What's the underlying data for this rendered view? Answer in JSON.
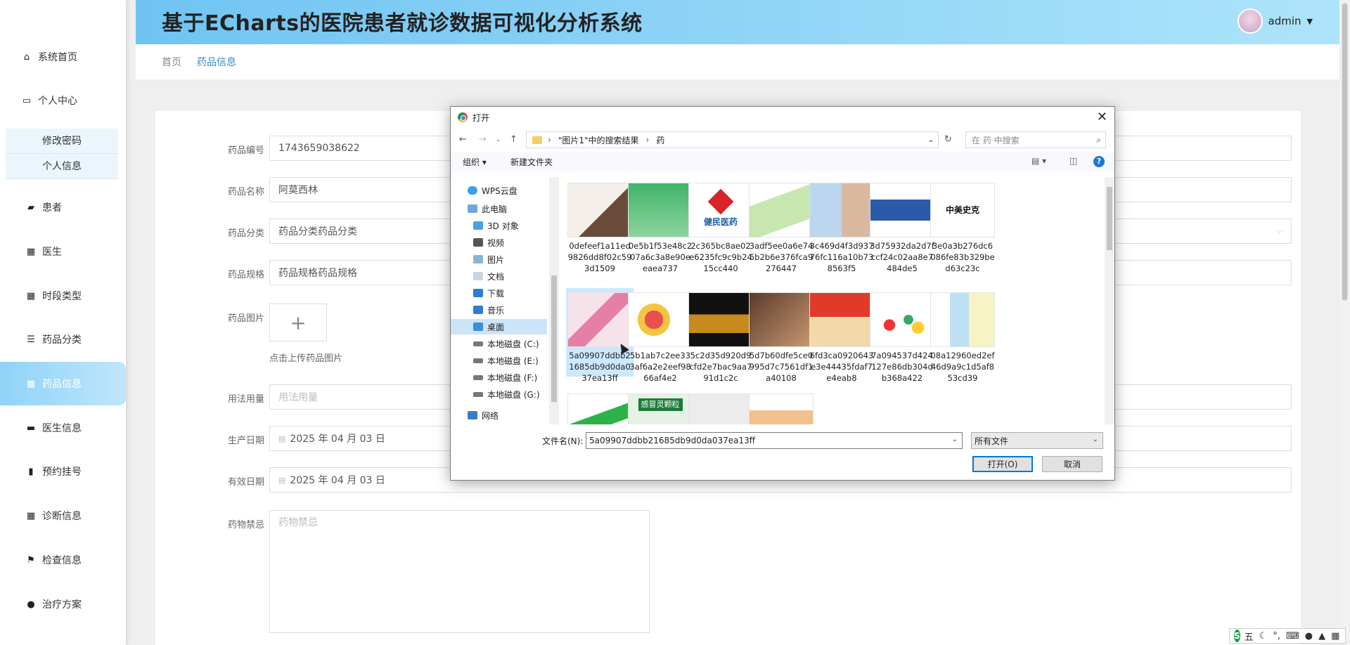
{
  "app": {
    "title": "基于ECharts的医院患者就诊数据可视化分析系统",
    "user": "admin"
  },
  "breadcrumb": {
    "home": "首页",
    "current": "药品信息"
  },
  "sidebar": {
    "items": [
      {
        "label": "系统首页",
        "icon": "home-icon"
      },
      {
        "label": "个人中心",
        "icon": "user-card-icon"
      },
      {
        "label": "患者",
        "icon": "patient-icon"
      },
      {
        "label": "医生",
        "icon": "grid-icon"
      },
      {
        "label": "时段类型",
        "icon": "grid-icon"
      },
      {
        "label": "药品分类",
        "icon": "list-icon"
      },
      {
        "label": "药品信息",
        "icon": "grid-icon"
      },
      {
        "label": "医生信息",
        "icon": "doctor-icon"
      },
      {
        "label": "预约挂号",
        "icon": "bar-icon"
      },
      {
        "label": "诊断信息",
        "icon": "grid-icon"
      },
      {
        "label": "检查信息",
        "icon": "flag-icon"
      },
      {
        "label": "治疗方案",
        "icon": "person-icon"
      }
    ],
    "submenu": [
      "修改密码",
      "个人信息"
    ]
  },
  "form": {
    "code_label": "药品编号",
    "code_value": "1743659038622",
    "name_label": "药品名称",
    "name_value": "阿莫西林",
    "category_label": "药品分类",
    "category_value": "药品分类药品分类",
    "spec_label": "药品规格",
    "spec_value": "药品规格药品规格",
    "image_label": "药品图片",
    "upload_hint": "点击上传药品图片",
    "upload_plus": "+",
    "usage_label": "用法用量",
    "usage_placeholder": "用法用量",
    "prod_label": "生产日期",
    "prod_value": "2025 年 04 月 03 日",
    "expiry_label": "有效日期",
    "expiry_value": "2025 年 04 月 03 日",
    "taboo_label": "药物禁忌",
    "taboo_placeholder": "药物禁忌"
  },
  "dialog": {
    "title": "打开",
    "path": [
      "\"图片1\"中的搜索结果",
      "药"
    ],
    "search_placeholder": "在 药 中搜索",
    "organize": "组织 ▾",
    "new_folder": "新建文件夹",
    "tree": [
      "WPS云盘",
      "此电脑",
      "3D 对象",
      "视频",
      "图片",
      "文档",
      "下载",
      "音乐",
      "桌面",
      "本地磁盘 (C:)",
      "本地磁盘 (E:)",
      "本地磁盘 (F:)",
      "本地磁盘 (G:)",
      "网络"
    ],
    "files": [
      "0defeef1a11ed9826dd8f02c593d1509",
      "0e5b1f53e48c207a6c3a8e90eeaea737",
      "2c365bc8ae02e6235fc9c9b2415cc440",
      "3adf5ee0a6e745b2b6e376fca9276447",
      "3c469d4f3d93776fc116a10b738563f5",
      "3d75932da2d7fccf24c02aa8e7484de5",
      "3e0a3b276dc6086fe83b329bed63c23c",
      "5a09907ddbb21685db9d0da037ea13ff",
      "5b1ab7c2ee333af6a2e2eef9866af4e2",
      "5c2d35d920d9cfd2e7bac9aa791d1c2c",
      "5d7b60dfe5ce0995d7c7561df1a40108",
      "6fd3ca0920643e3e44435fdaf7e4eab8",
      "7a094537d424127e86db304db368a422",
      "08a12960ed2ef46d9a9c1d5af853cd39"
    ],
    "thumb_texts": {
      "logo1": "健民医药",
      "logo2": "中美史克",
      "box1": "感冒灵颗粒"
    },
    "filename_label": "文件名(N):",
    "filename_value": "5a09907ddbb21685db9d0da037ea13ff",
    "filetype": "所有文件",
    "open_button": "打开(O)",
    "cancel_button": "取消"
  },
  "ime": {
    "mode": "五"
  }
}
